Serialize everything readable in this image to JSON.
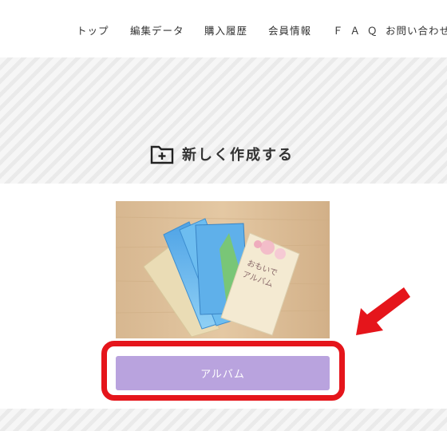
{
  "nav": {
    "items": [
      "トップ",
      "編集データ",
      "購入履歴",
      "会員情報",
      "ＦＡＱ",
      "お問い合わせ"
    ]
  },
  "section": {
    "title": "新しく作成する",
    "icon": "folder-plus-icon"
  },
  "product": {
    "image_icon": "album-books-photo",
    "book_cover_title": "おもいで\nアルバム",
    "button_label": "アルバム"
  },
  "colors": {
    "button": "#b9a3de",
    "highlight": "#e5151b",
    "arrow": "#e5151b",
    "stripe_light": "#f6f6f6",
    "stripe_dark": "#eaeaea"
  }
}
